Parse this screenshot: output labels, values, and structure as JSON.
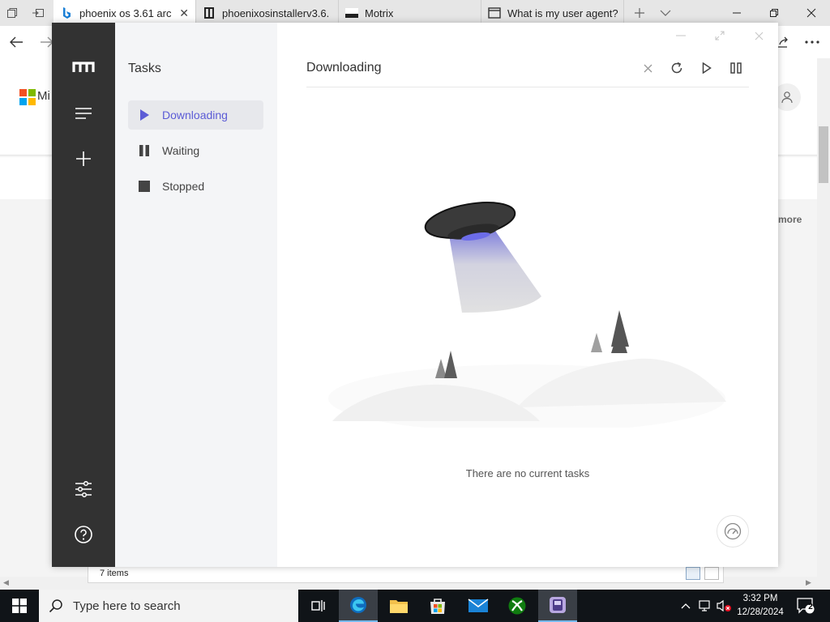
{
  "browser": {
    "tabs": [
      {
        "title": "phoenix os 3.61 arc",
        "icon": "bing-icon",
        "active": true
      },
      {
        "title": "phoenixosinstallerv3.6.",
        "icon": "archive-icon",
        "active": false
      },
      {
        "title": "Motrix",
        "icon": "motrix-tab-icon",
        "active": false
      },
      {
        "title": "What is my user agent?",
        "icon": "window-icon",
        "active": false
      }
    ],
    "page": {
      "logo_text": "Mi",
      "more_text": "more",
      "status_items": "7 items"
    }
  },
  "motrix": {
    "sidebar_icons": [
      "motrix-logo-icon",
      "menu-icon",
      "add-task-icon",
      "preferences-icon",
      "help-icon"
    ],
    "subnav_title": "Tasks",
    "subnav_items": [
      {
        "label": "Downloading",
        "icon": "play-icon",
        "active": true
      },
      {
        "label": "Waiting",
        "icon": "pause-icon",
        "active": false
      },
      {
        "label": "Stopped",
        "icon": "stop-icon",
        "active": false
      }
    ],
    "main_title": "Downloading",
    "empty_text": "There are no current tasks",
    "accent_color": "#5b5bd6"
  },
  "taskbar": {
    "search_placeholder": "Type here to search",
    "time": "3:32 PM",
    "date": "12/28/2024",
    "notification_count": "2"
  }
}
